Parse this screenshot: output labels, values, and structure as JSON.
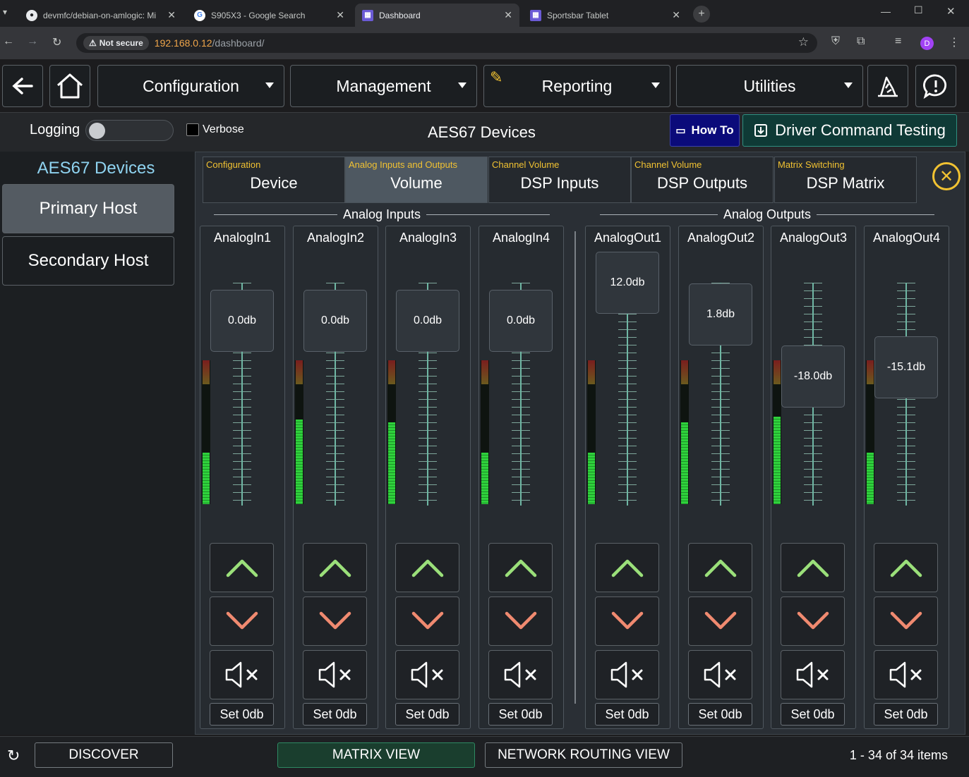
{
  "browser": {
    "tabs": [
      {
        "title": "devmfc/debian-on-amlogic: Mi",
        "active": false
      },
      {
        "title": "S905X3 - Google Search",
        "active": false
      },
      {
        "title": "Dashboard",
        "active": true
      },
      {
        "title": "Sportsbar Tablet",
        "active": false
      }
    ],
    "not_secure_label": "Not secure",
    "url_host": "192.168.0.12",
    "url_path": "/dashboard/",
    "profile_initial": "D"
  },
  "nav": {
    "configuration": "Configuration",
    "management": "Management",
    "reporting": "Reporting",
    "utilities": "Utilities"
  },
  "subbar": {
    "logging_label": "Logging",
    "verbose_label": "Verbose",
    "page_title": "AES67 Devices",
    "how_to": "How To",
    "driver_testing": "Driver Command Testing"
  },
  "left_panel": {
    "title": "AES67 Devices",
    "primary": "Primary Host",
    "secondary": "Secondary Host"
  },
  "tabs": [
    {
      "small": "Configuration",
      "big": "Device",
      "selected": false
    },
    {
      "small": "Analog Inputs and Outputs",
      "big": "Volume",
      "selected": true
    },
    {
      "small": "Channel Volume",
      "big": "DSP Inputs",
      "selected": false
    },
    {
      "small": "Channel Volume",
      "big": "DSP Outputs",
      "selected": false
    },
    {
      "small": "Matrix Switching",
      "big": "DSP Matrix",
      "selected": false
    }
  ],
  "sections": {
    "inputs": "Analog Inputs",
    "outputs": "Analog Outputs"
  },
  "channels": [
    {
      "name": "AnalogIn1",
      "gain": "0.0db",
      "level": 0.36
    },
    {
      "name": "AnalogIn2",
      "gain": "0.0db",
      "level": 0.59
    },
    {
      "name": "AnalogIn3",
      "gain": "0.0db",
      "level": 0.57
    },
    {
      "name": "AnalogIn4",
      "gain": "0.0db",
      "level": 0.36
    },
    {
      "name": "AnalogOut1",
      "gain": "12.0db",
      "level": 0.36
    },
    {
      "name": "AnalogOut2",
      "gain": "1.8db",
      "level": 0.57
    },
    {
      "name": "AnalogOut3",
      "gain": "-18.0db",
      "level": 0.61
    },
    {
      "name": "AnalogOut4",
      "gain": "-15.1db",
      "level": 0.36
    }
  ],
  "set_0db_label": "Set 0db",
  "footer": {
    "discover": "DISCOVER",
    "matrix_view": "MATRIX VIEW",
    "network_routing": "NETWORK ROUTING VIEW",
    "items": "1 - 34 of 34 items"
  },
  "colors": {
    "accent_yellow": "#f1c232",
    "up": "#9be07a",
    "down": "#f08a70",
    "meter_green": "#2fd23c"
  }
}
